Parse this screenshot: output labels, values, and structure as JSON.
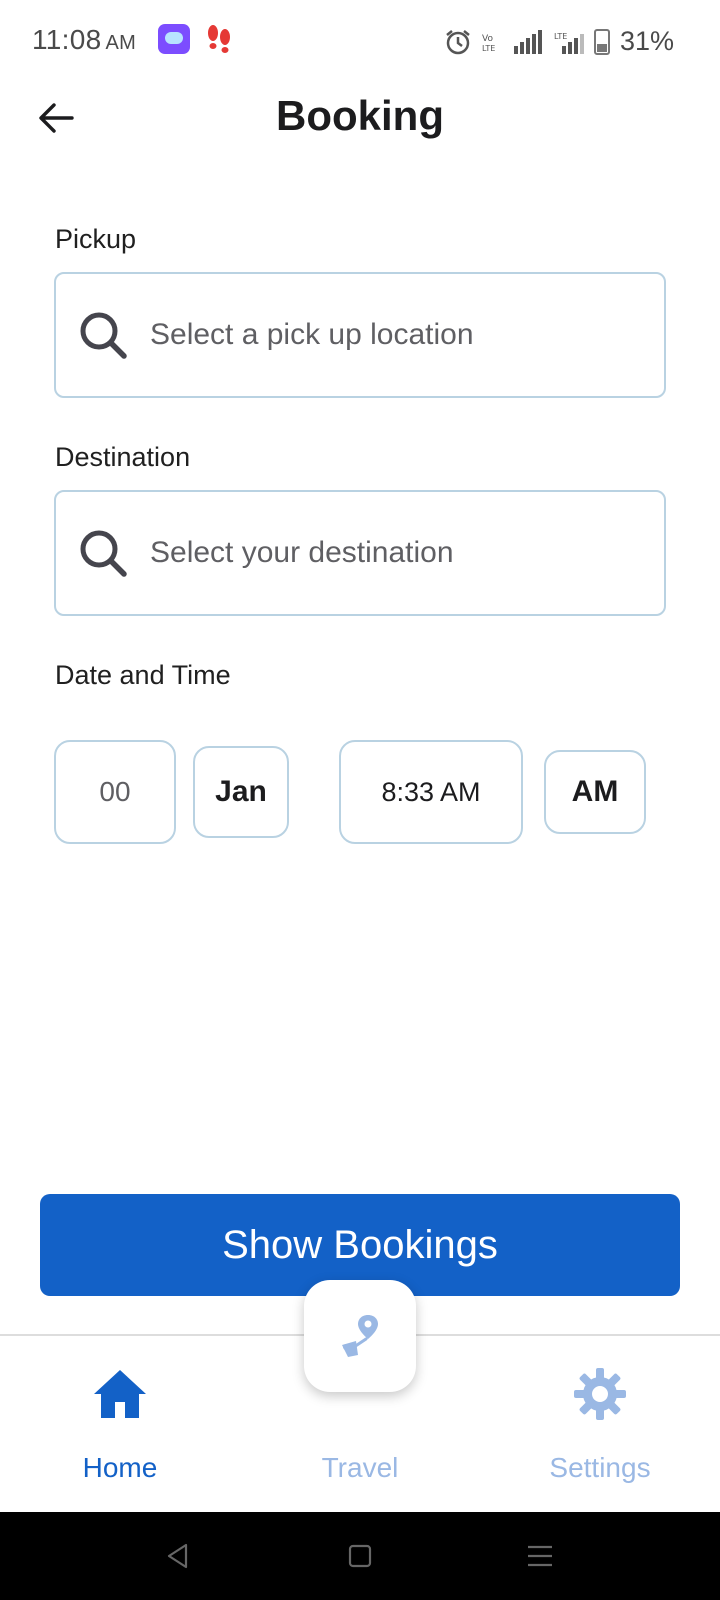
{
  "status_bar": {
    "time": "11:08",
    "time_suffix": "AM",
    "battery": "31%",
    "icons": [
      "chat-app-icon",
      "footsteps-icon",
      "alarm-icon",
      "volte-icon",
      "signal-icon",
      "lte-signal-icon",
      "battery-icon"
    ]
  },
  "header": {
    "title": "Booking",
    "back_icon": "arrow-left-icon"
  },
  "form": {
    "pickup": {
      "label": "Pickup",
      "placeholder": "Select a pick up location",
      "icon": "search-icon"
    },
    "destination": {
      "label": "Destination",
      "placeholder": "Select your destination",
      "icon": "search-icon"
    },
    "date_time": {
      "label": "Date and Time",
      "day": "00",
      "month": "Jan",
      "time": "8:33 AM",
      "period": "AM"
    }
  },
  "actions": {
    "show_bookings": "Show Bookings"
  },
  "bottom_nav": {
    "items": [
      {
        "label": "Home",
        "icon": "home-icon",
        "active": true
      },
      {
        "label": "Travel",
        "icon": "route-pin-icon",
        "active": false
      },
      {
        "label": "Settings",
        "icon": "gear-icon",
        "active": false
      }
    ],
    "fab_icon": "route-pin-icon"
  },
  "colors": {
    "primary": "#1361c7",
    "active_nav": "#1361c7",
    "inactive_nav": "#9ab8e4",
    "border": "#b9d2e2",
    "text": "#1c1c1e"
  }
}
